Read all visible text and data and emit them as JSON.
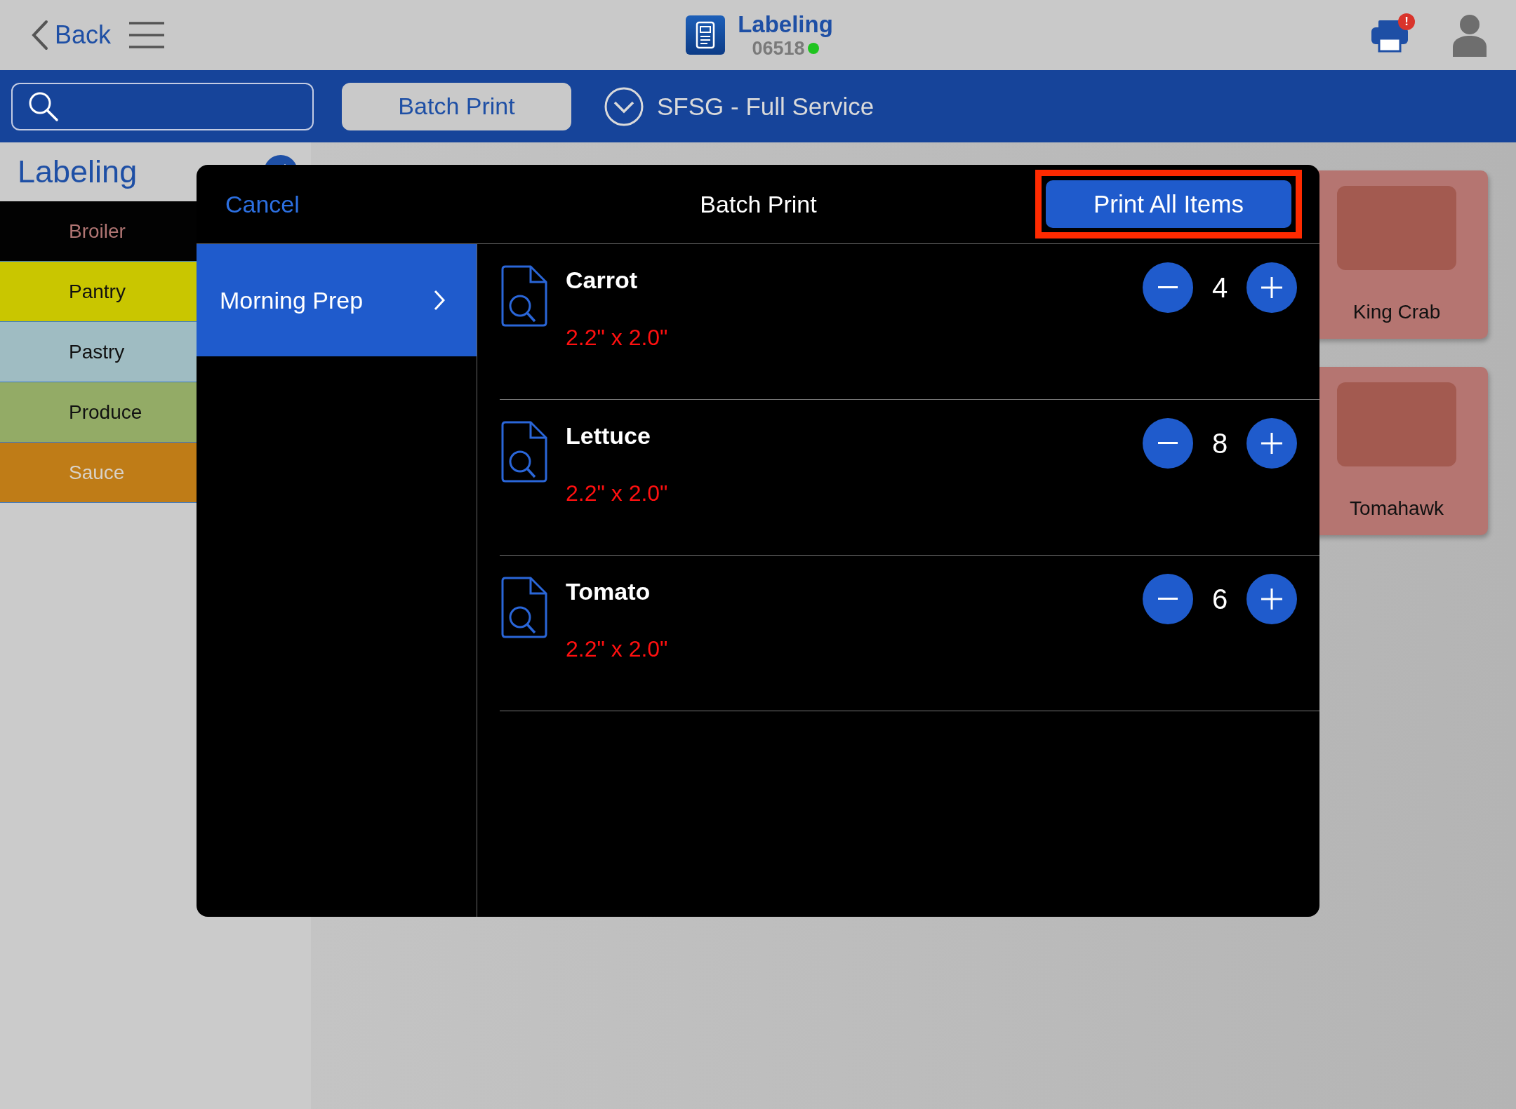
{
  "top_bar": {
    "back": "Back",
    "app_title": "Labeling",
    "device_id": "06518",
    "device_online": true,
    "printer_alert": "!"
  },
  "toolbar": {
    "batch_print": "Batch Print",
    "location": "SFSG - Full Service"
  },
  "sidebar": {
    "title": "Labeling",
    "categories": [
      {
        "label": "Broiler",
        "color": "#020202"
      },
      {
        "label": "Pantry",
        "color": "#c9c600"
      },
      {
        "label": "Pastry",
        "color": "#9fbcc2"
      },
      {
        "label": "Produce",
        "color": "#93ab66"
      },
      {
        "label": "Sauce",
        "color": "#bf7c17"
      }
    ]
  },
  "cards": [
    {
      "label": "King Crab"
    },
    {
      "label": "Tomahawk"
    }
  ],
  "dialog": {
    "cancel": "Cancel",
    "title": "Batch Print",
    "print_all": {
      "label": "Print All Items",
      "highlighted": true
    },
    "groups": [
      {
        "label": "Morning Prep",
        "selected": true
      }
    ],
    "items": [
      {
        "name": "Carrot",
        "size": "2.2\" x 2.0\"",
        "count": "4"
      },
      {
        "name": "Lettuce",
        "size": "2.2\" x 2.0\"",
        "count": "8"
      },
      {
        "name": "Tomato",
        "size": "2.2\" x 2.0\"",
        "count": "6"
      }
    ]
  }
}
